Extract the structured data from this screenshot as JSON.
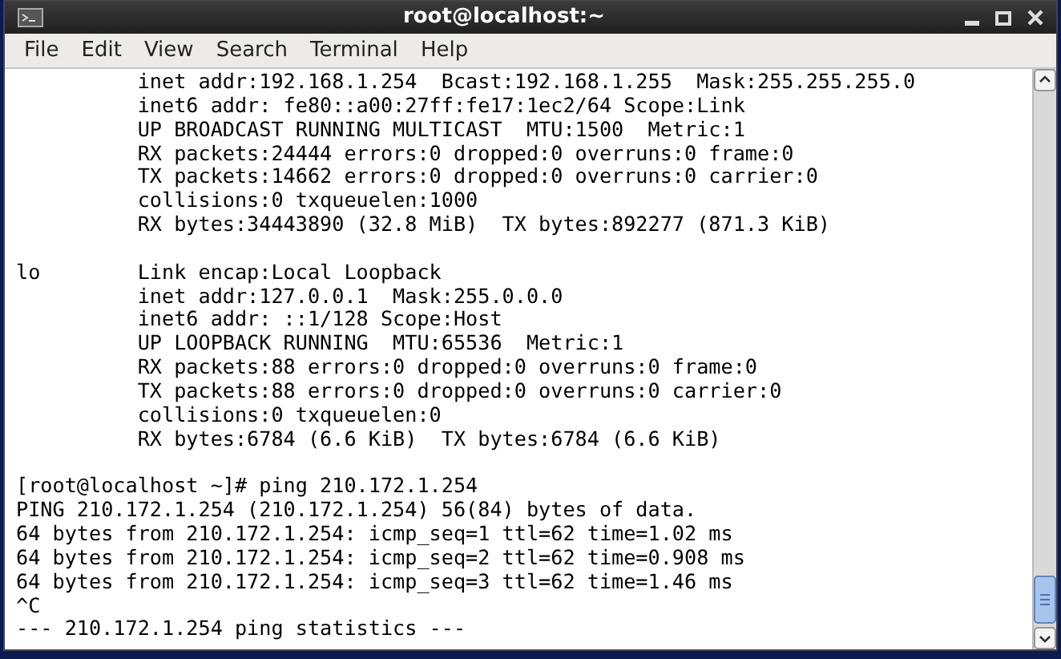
{
  "window": {
    "title": "root@localhost:~"
  },
  "menu": [
    "File",
    "Edit",
    "View",
    "Search",
    "Terminal",
    "Help"
  ],
  "terminal": {
    "lines": [
      {
        "text": "          inet addr:192.168.1.254  Bcast:192.168.1.255  Mask:255.255.255.0"
      },
      {
        "text": "          inet6 addr: fe80::a00:27ff:fe17:1ec2/64 Scope:Link"
      },
      {
        "text": "          UP BROADCAST RUNNING MULTICAST  MTU:1500  Metric:1"
      },
      {
        "text": "          RX packets:24444 errors:0 dropped:0 overruns:0 frame:0"
      },
      {
        "text": "          TX packets:14662 errors:0 dropped:0 overruns:0 carrier:0"
      },
      {
        "text": "          collisions:0 txqueuelen:1000"
      },
      {
        "text": "          RX bytes:34443890 (32.8 MiB)  TX bytes:892277 (871.3 KiB)"
      },
      {
        "text": "lo        Link encap:Local Loopback",
        "gap_before": true
      },
      {
        "text": "          inet addr:127.0.0.1  Mask:255.0.0.0"
      },
      {
        "text": "          inet6 addr: ::1/128 Scope:Host"
      },
      {
        "text": "          UP LOOPBACK RUNNING  MTU:65536  Metric:1"
      },
      {
        "text": "          RX packets:88 errors:0 dropped:0 overruns:0 frame:0"
      },
      {
        "text": "          TX packets:88 errors:0 dropped:0 overruns:0 carrier:0"
      },
      {
        "text": "          collisions:0 txqueuelen:0"
      },
      {
        "text": "          RX bytes:6784 (6.6 KiB)  TX bytes:6784 (6.6 KiB)"
      },
      {
        "text": "[root@localhost ~]# ping 210.172.1.254",
        "gap_before": true
      },
      {
        "text": "PING 210.172.1.254 (210.172.1.254) 56(84) bytes of data."
      },
      {
        "text": "64 bytes from 210.172.1.254: icmp_seq=1 ttl=62 time=1.02 ms"
      },
      {
        "text": "64 bytes from 210.172.1.254: icmp_seq=2 ttl=62 time=0.908 ms"
      },
      {
        "text": "64 bytes from 210.172.1.254: icmp_seq=3 ttl=62 time=1.46 ms"
      },
      {
        "text": "^C"
      },
      {
        "text": "--- 210.172.1.254 ping statistics ---"
      }
    ]
  }
}
